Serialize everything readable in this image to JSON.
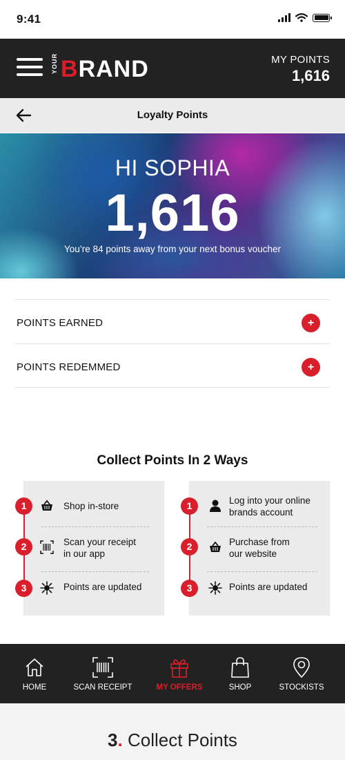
{
  "status_bar": {
    "time": "9:41"
  },
  "header": {
    "logo_small": "YOUR",
    "logo_b": "B",
    "logo_rest": "RAND",
    "my_points_label": "MY POINTS",
    "my_points_value": "1,616"
  },
  "subheader": {
    "title": "Loyalty Points"
  },
  "hero": {
    "greeting": "HI SOPHIA",
    "points": "1,616",
    "note": "You’re 84 points away from your next bonus voucher"
  },
  "accordion": [
    {
      "label": "POINTS EARNED",
      "icon": "plus-icon"
    },
    {
      "label": "POINTS REDEMMED",
      "icon": "plus-icon"
    }
  ],
  "collect": {
    "title": "Collect Points In 2 Ways",
    "in_store": [
      {
        "number": "1",
        "icon": "basket-icon",
        "text": "Shop in-store"
      },
      {
        "number": "2",
        "icon": "barcode-scan-icon",
        "line1": "Scan your receipt",
        "line2": "in our app"
      },
      {
        "number": "3",
        "icon": "sparkle-icon",
        "text": "Points are updated"
      }
    ],
    "online": [
      {
        "number": "1",
        "icon": "person-icon",
        "line1": "Log into your online",
        "line2": "brands account"
      },
      {
        "number": "2",
        "icon": "basket-icon",
        "line1": "Purchase from",
        "line2": "our website"
      },
      {
        "number": "3",
        "icon": "sparkle-icon",
        "text": "Points are updated"
      }
    ]
  },
  "bottom_nav": [
    {
      "label": "HOME",
      "icon": "home-icon"
    },
    {
      "label": "SCAN RECEIPT",
      "icon": "barcode-scan-icon"
    },
    {
      "label": "MY OFFERS",
      "icon": "gift-icon",
      "active": true
    },
    {
      "label": "SHOP",
      "icon": "shopping-bag-icon"
    },
    {
      "label": "STOCKISTS",
      "icon": "location-pin-icon"
    }
  ],
  "caption": {
    "number": "3",
    "dot": ".",
    "text": " Collect Points"
  },
  "colors": {
    "accent": "#d91f2b",
    "dark": "#222222",
    "panel": "#ebebeb"
  }
}
